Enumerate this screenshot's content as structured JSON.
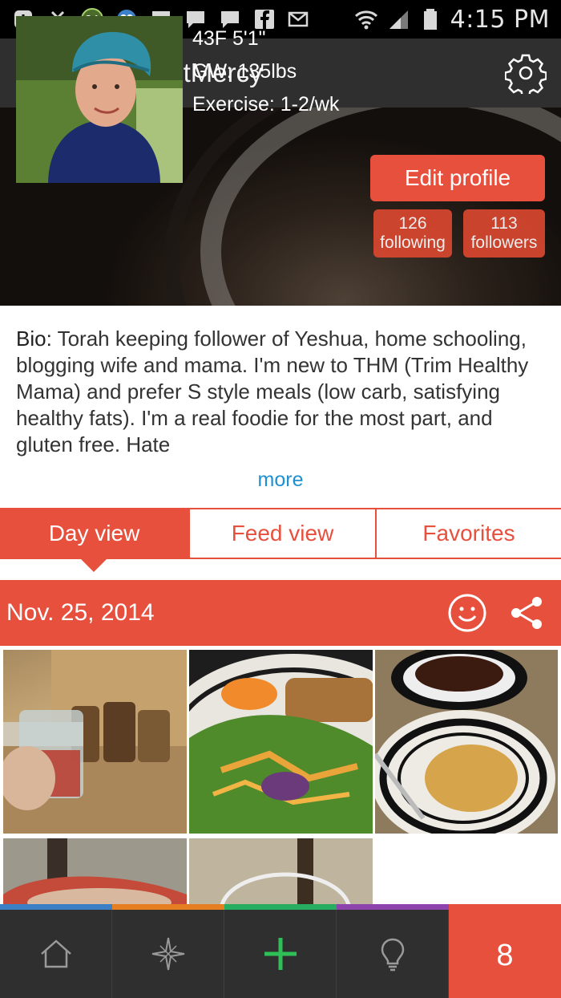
{
  "status_bar": {
    "time": "4:15 PM",
    "notification_badge": "24",
    "icons": [
      "add-box-icon",
      "missed-call-icon",
      "badge-24-icon",
      "bird-app-icon",
      "chat-icon",
      "chat-icon",
      "chat-icon",
      "facebook-icon",
      "email-icon",
      "wifi-icon",
      "signal-icon",
      "battery-icon"
    ]
  },
  "app_bar": {
    "title": "OhSweetMercy",
    "settings_icon": "gear-icon"
  },
  "profile": {
    "stats_line1": "43F  5'1\"",
    "stats_line2": "GW: 135lbs",
    "stats_line3": "Exercise: 1-2/wk",
    "edit_label": "Edit profile",
    "following_count": "126",
    "following_label": "following",
    "followers_count": "113",
    "followers_label": "followers"
  },
  "bio": {
    "label": "Bio:",
    "text": "Torah keeping follower of Yeshua, home schooling, blogging wife and mama. I'm new to THM (Trim Healthy Mama) and prefer S style meals (low carb, satisfying healthy fats). I'm a real foodie for the most part, and gluten free. Hate",
    "more_label": "more"
  },
  "tabs": [
    {
      "label": "Day view",
      "active": true
    },
    {
      "label": "Feed view",
      "active": false
    },
    {
      "label": "Favorites",
      "active": false
    }
  ],
  "day": {
    "date": "Nov. 25, 2014"
  },
  "bottom_nav": {
    "items": [
      "home-icon",
      "explore-star-icon",
      "add-plus-icon",
      "lightbulb-icon",
      "profile-8-icon"
    ],
    "profile_glyph": "8",
    "strip_colors": [
      "#3b7fc4",
      "#e67e22",
      "#27ae60",
      "#8e44ad",
      "#e8503e"
    ]
  },
  "colors": {
    "accent": "#e8503e",
    "header_bg": "#2f2f2f",
    "link": "#1e8fcf"
  }
}
